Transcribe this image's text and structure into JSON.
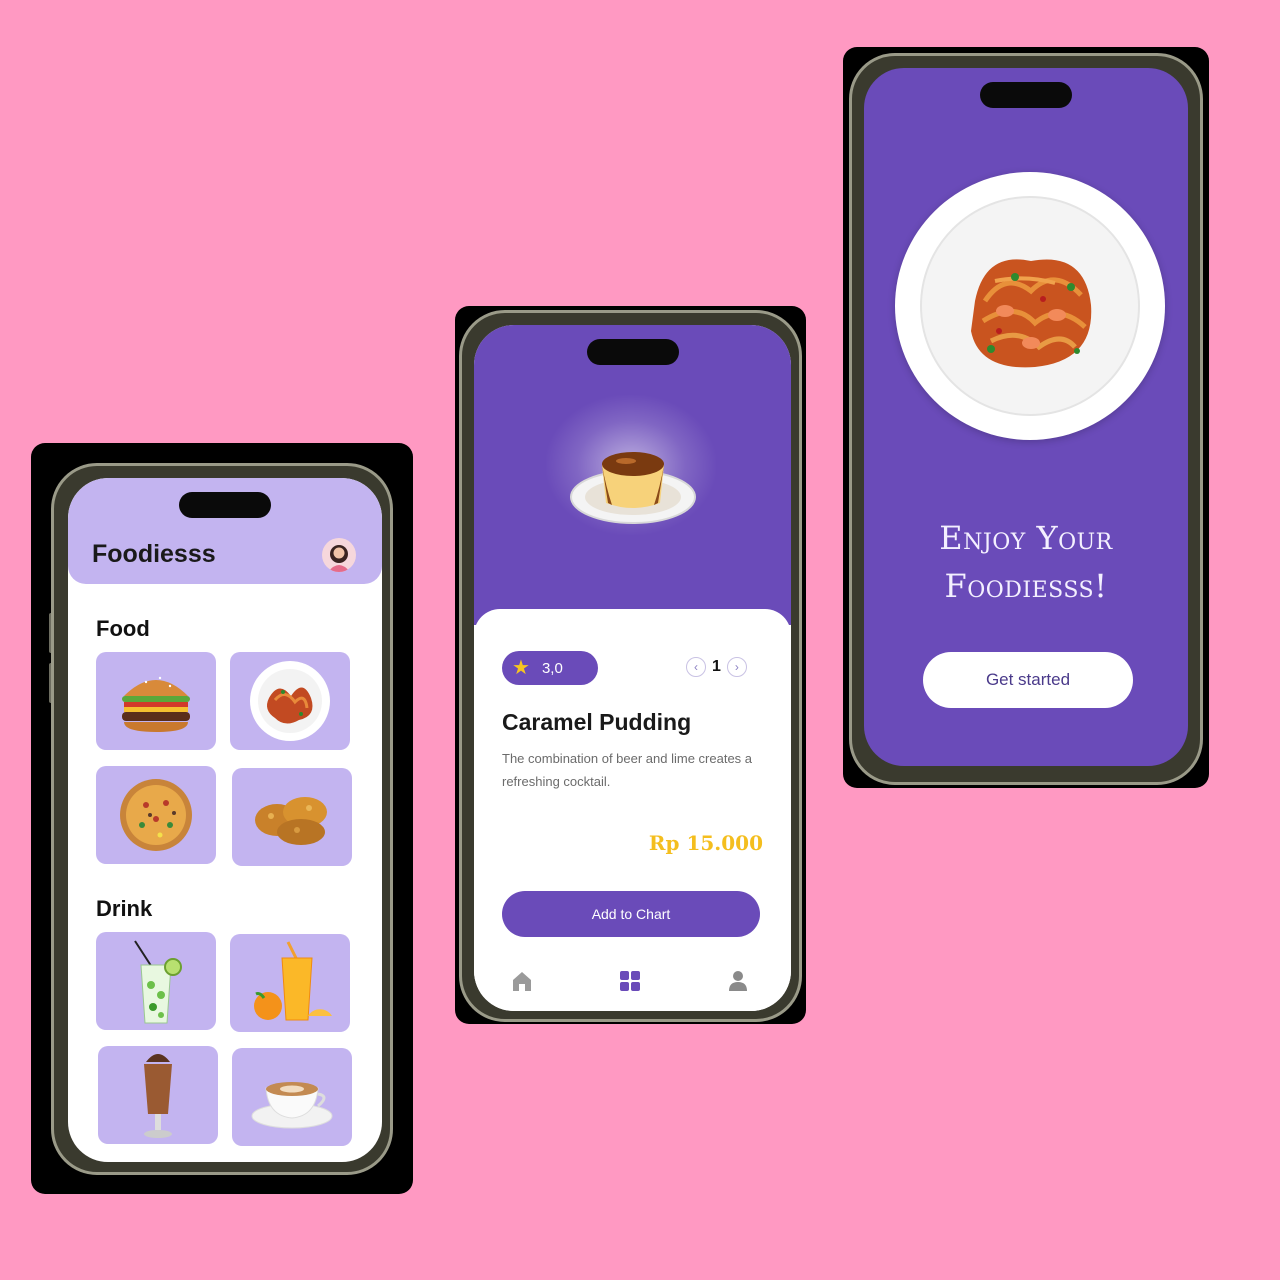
{
  "screen_home": {
    "app_title": "Foodiesss",
    "food_section_label": "Food",
    "drink_section_label": "Drink",
    "food_items": [
      "burger-image",
      "spaghetti-image",
      "pizza-image",
      "fried-chicken-image"
    ],
    "drink_items": [
      "mojito-image",
      "orange-juice-image",
      "milkshake-image",
      "coffee-image"
    ]
  },
  "screen_detail": {
    "rating": "3,0",
    "quantity": "1",
    "item_name": "Caramel Pudding",
    "description": "The combination of beer and lime creates a refreshing cocktail.",
    "price": "Rp 15.000",
    "cta_label": "Add to Chart",
    "nav_icons": [
      "home-icon",
      "grid-icon",
      "user-icon"
    ]
  },
  "screen_welcome": {
    "headline_line1": "Enjoy Your",
    "headline_line2": "Foodiesss!",
    "cta_label": "Get started"
  },
  "colors": {
    "background": "#ff99c2",
    "primary": "#6a4bb9",
    "tile": "#c3b4f0",
    "price": "#f4be1e"
  }
}
